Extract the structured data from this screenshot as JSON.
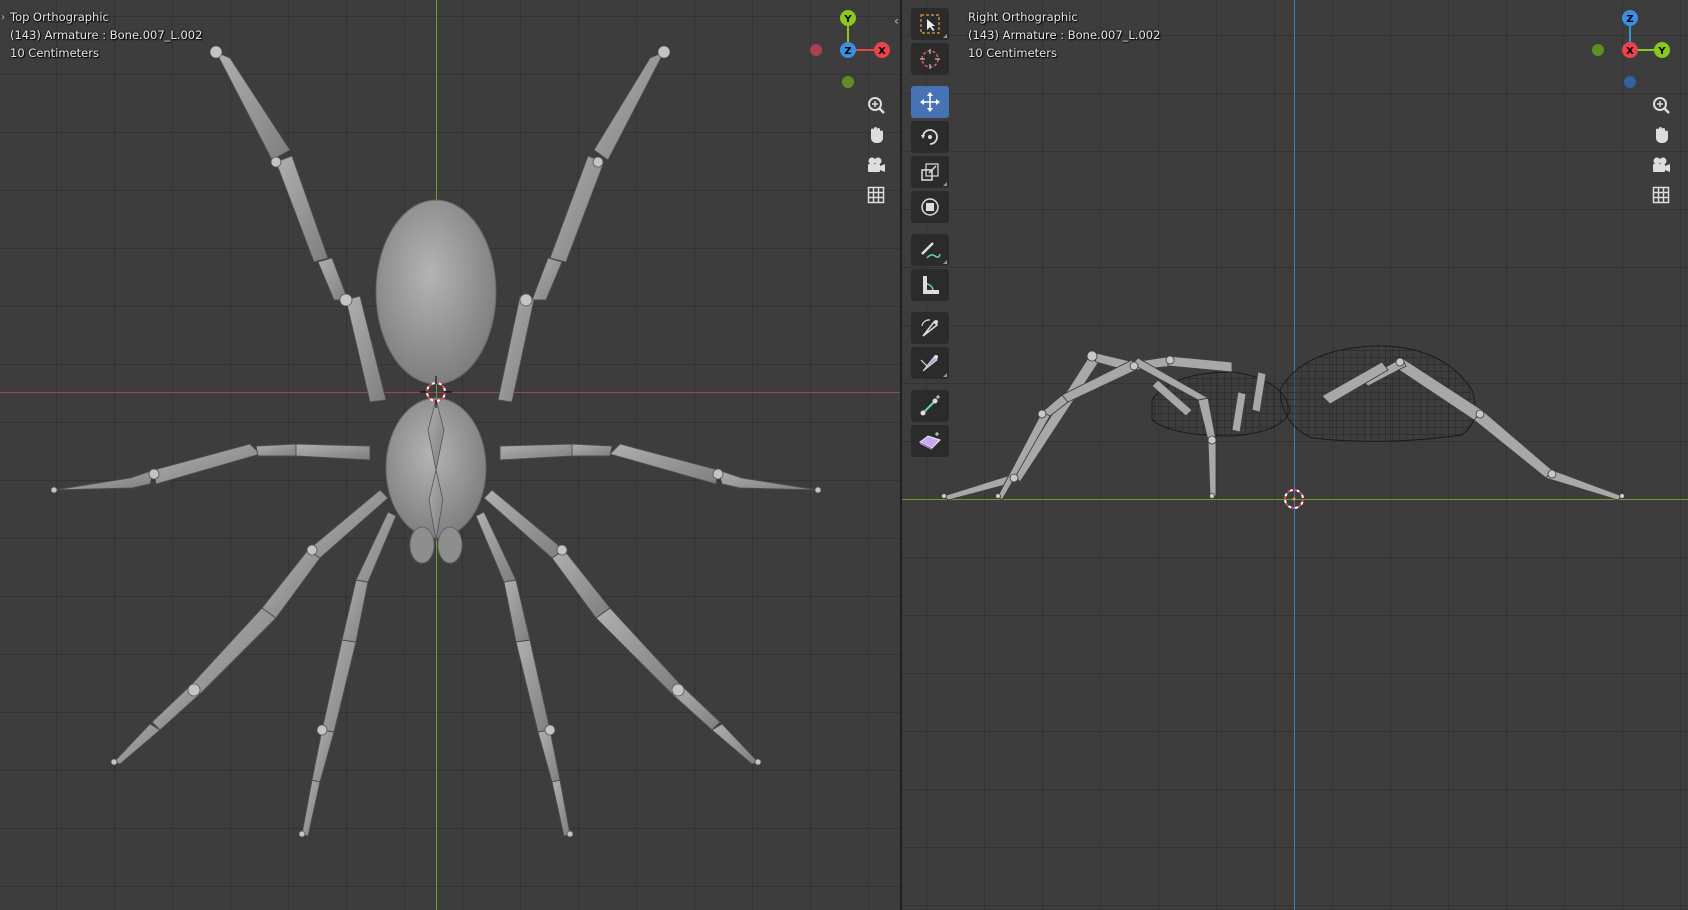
{
  "left_viewport": {
    "view_name": "Top Orthographic",
    "object_info": "(143) Armature : Bone.007_L.002",
    "scale": "10 Centimeters",
    "gizmo": {
      "up_label": "Y",
      "center_label": "Z",
      "right_label": "X",
      "colors": {
        "x": "#e8444f",
        "y": "#8ac81d",
        "z": "#3b8fe0"
      }
    }
  },
  "right_viewport": {
    "view_name": "Right Orthographic",
    "object_info": "(143) Armature : Bone.007_L.002",
    "scale": "10 Centimeters",
    "gizmo": {
      "up_label": "Z",
      "center_label": "X",
      "right_label": "Y",
      "colors": {
        "x": "#e8444f",
        "y": "#8ac81d",
        "z": "#3b8fe0"
      }
    }
  },
  "navigation": [
    "zoom-icon",
    "pan-hand-icon",
    "camera-icon",
    "grid-toggle-icon"
  ],
  "toolbar": {
    "tools": [
      {
        "name": "select-box",
        "active": false
      },
      {
        "name": "cursor",
        "active": false
      },
      {
        "name": "move",
        "active": true
      },
      {
        "name": "rotate",
        "active": false
      },
      {
        "name": "scale",
        "active": false
      },
      {
        "name": "transform",
        "active": false
      },
      {
        "name": "annotate",
        "active": false
      },
      {
        "name": "measure",
        "active": false
      },
      {
        "name": "bone-roll",
        "active": false
      },
      {
        "name": "bone-size",
        "active": false
      },
      {
        "name": "extrude",
        "active": false
      },
      {
        "name": "bone-envelope",
        "active": false
      }
    ]
  },
  "colors": {
    "x_axis": "#a8434e",
    "y_axis": "#6e9e2a",
    "z_axis": "#3f7fc4",
    "active_tool": "#4772b3"
  }
}
